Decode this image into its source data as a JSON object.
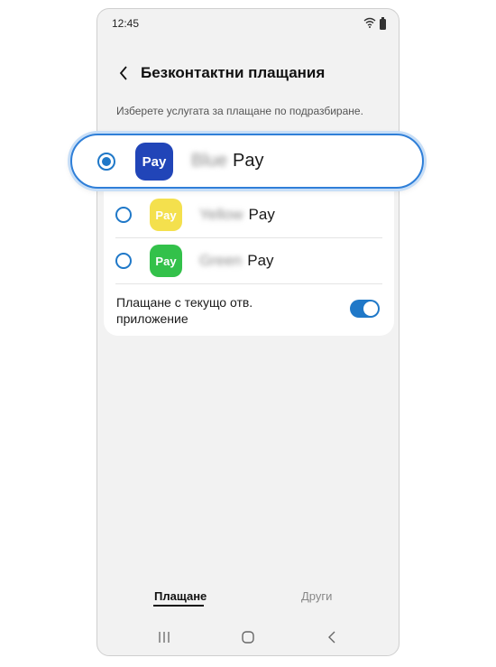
{
  "status_bar": {
    "time": "12:45"
  },
  "header": {
    "title": "Безконтактни плащания"
  },
  "subtitle": "Изберете услугата за плащане по подразбиране.",
  "payment_options": [
    {
      "icon_text": "Pay",
      "name_blurred": "Blue",
      "name": "Pay",
      "selected": true,
      "color": "#2145b8"
    },
    {
      "icon_text": "Pay",
      "name_blurred": "Yellow",
      "name": "Pay",
      "selected": false,
      "color": "#f4e04d"
    },
    {
      "icon_text": "Pay",
      "name_blurred": "Green",
      "name": "Pay",
      "selected": false,
      "color": "#33c14a"
    }
  ],
  "toggle_setting": {
    "label": "Плащане с текущо отв. приложение",
    "enabled": true
  },
  "tabs": [
    {
      "label": "Плащане",
      "active": true
    },
    {
      "label": "Други",
      "active": false
    }
  ],
  "colors": {
    "accent": "#1f78c8",
    "highlight_border": "#2f7fd8"
  },
  "icons": {
    "back": "chevron-left-icon",
    "wifi": "wifi-icon",
    "battery": "battery-icon",
    "recents": "recents-icon",
    "home": "home-icon",
    "nav_back": "nav-back-icon"
  }
}
